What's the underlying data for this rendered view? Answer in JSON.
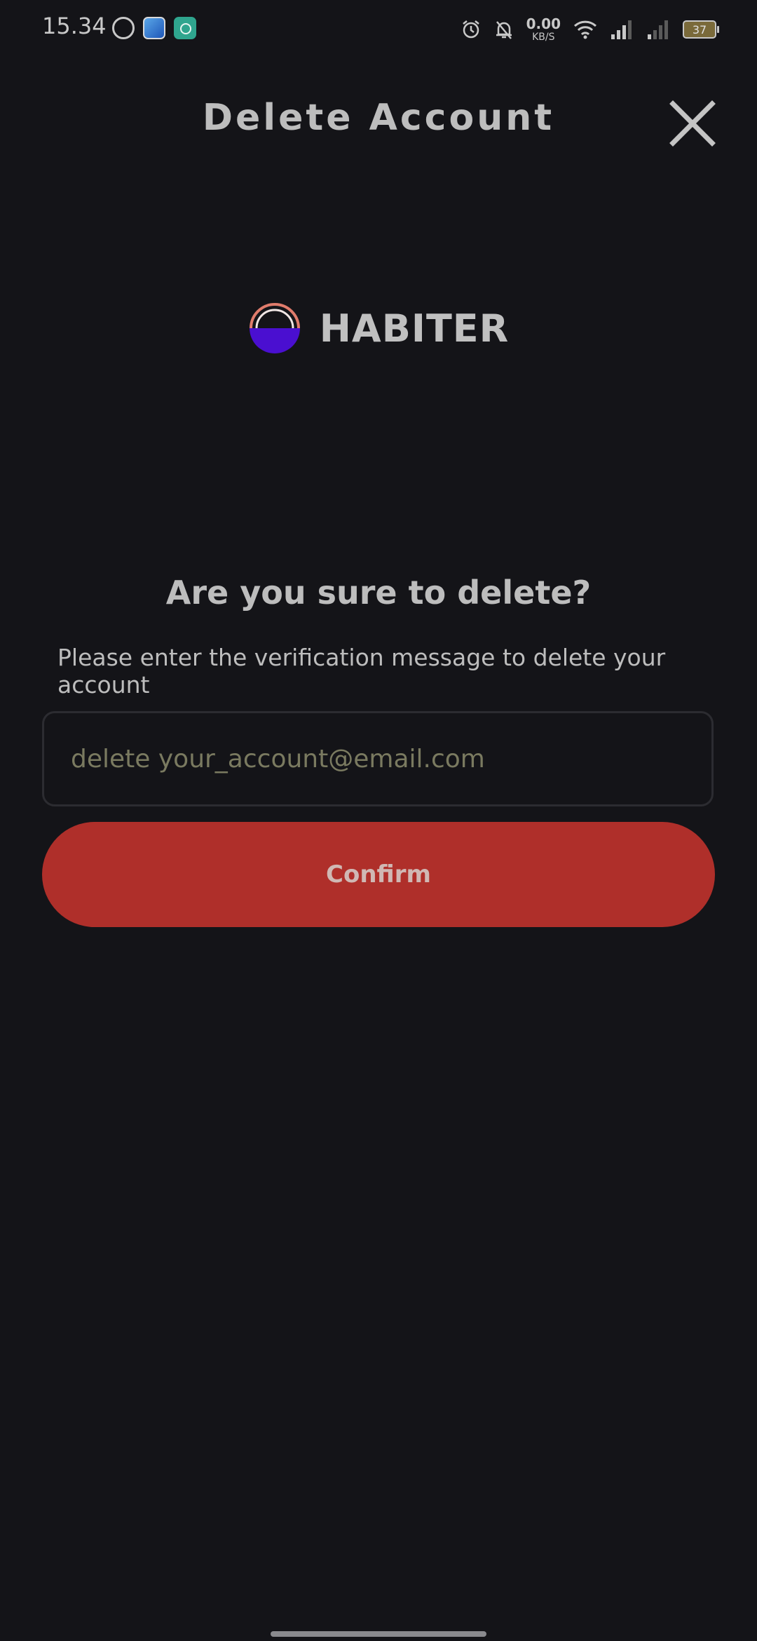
{
  "status_bar": {
    "time": "15.34",
    "net_speed_value": "0.00",
    "net_speed_unit": "KB/S",
    "battery": "37",
    "icons": [
      "whatsapp-icon",
      "blue-app-icon",
      "green-app-icon",
      "alarm-icon",
      "mute-icon",
      "wifi-icon",
      "signal-icon",
      "signal-icon-2",
      "battery-icon"
    ]
  },
  "header": {
    "title": "Delete Account",
    "close_icon": "close-icon"
  },
  "logo": {
    "name": "HABITER",
    "colors": {
      "arc": "#e07c6c",
      "fill": "#4a0fd0"
    }
  },
  "main": {
    "question": "Are you sure to delete?",
    "instruction": "Please enter the verification message to delete your account",
    "input": {
      "placeholder": "delete your_account@email.com",
      "value": ""
    },
    "confirm_label": "Confirm"
  },
  "colors": {
    "background": "#141418",
    "confirm": "#af2f2a"
  }
}
